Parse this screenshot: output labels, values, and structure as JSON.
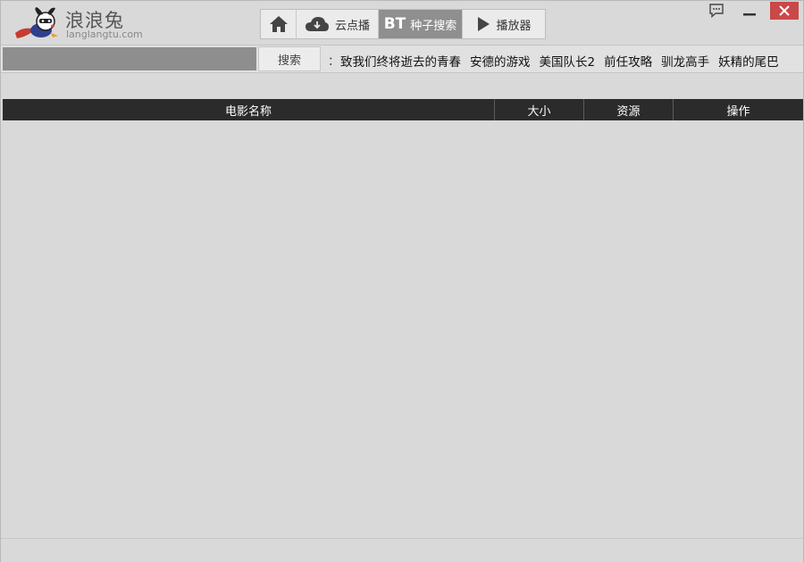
{
  "app": {
    "name": "浪浪兔",
    "url": "langlangtu.com"
  },
  "nav": {
    "tabs": [
      {
        "id": "home",
        "label": "",
        "icon": "home-icon"
      },
      {
        "id": "cloud",
        "label": "云点播",
        "icon": "cloud-icon"
      },
      {
        "id": "bt",
        "label": "种子搜索",
        "mark": "BT",
        "active": true
      },
      {
        "id": "player",
        "label": "播放器",
        "icon": "play-icon"
      }
    ]
  },
  "window_controls": {
    "feedback": "speech-bubble-icon",
    "minimize": "minimize-icon",
    "close": "close-icon"
  },
  "search": {
    "value": "",
    "button_label": "搜索",
    "separator": "：",
    "hot_keywords": [
      "致我们终将逝去的青春",
      "安德的游戏",
      "美国队长2",
      "前任攻略",
      "驯龙高手",
      "妖精的尾巴"
    ]
  },
  "table": {
    "columns": [
      "电影名称",
      "大小",
      "资源",
      "操作"
    ],
    "rows": []
  },
  "colors": {
    "background": "#d9d9d9",
    "active_tab": "#8f8f8f",
    "table_header": "#2b2b2b",
    "close_button": "#c94848"
  }
}
